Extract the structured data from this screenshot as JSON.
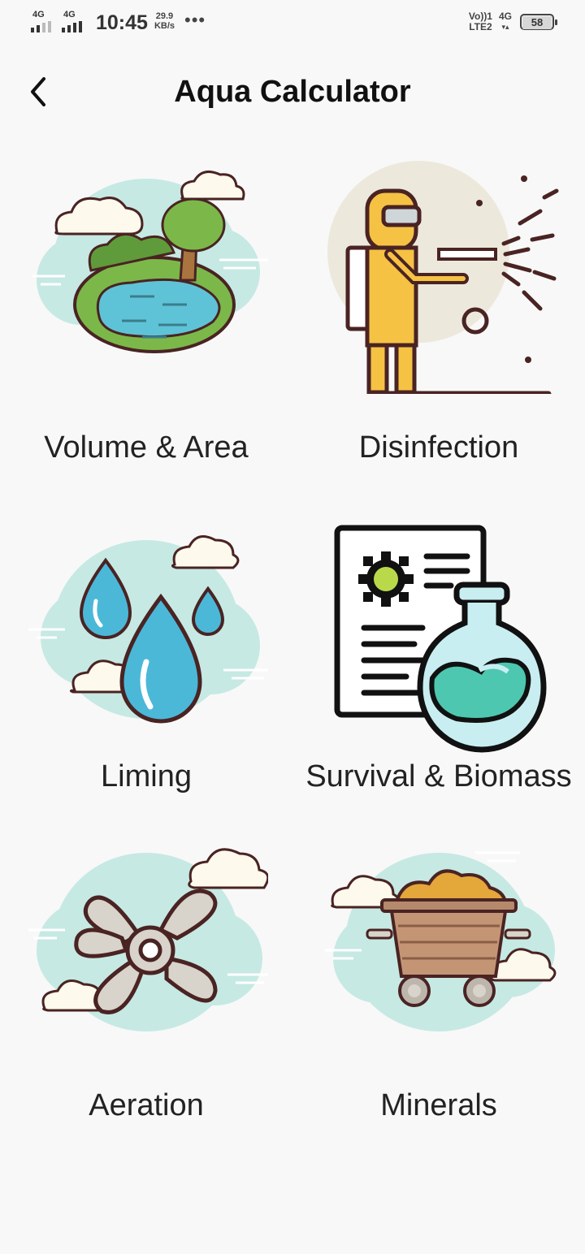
{
  "status_bar": {
    "network_1": "4G",
    "network_2": "4G",
    "time": "10:45",
    "speed_value": "29.9",
    "speed_unit": "KB/s",
    "more": "•••",
    "volte_1": "Vo))1",
    "volte_2": "LTE2",
    "network_right": "4G",
    "battery_level": "58"
  },
  "app_bar": {
    "title": "Aqua Calculator",
    "back_icon": "chevron-left-icon"
  },
  "tiles": [
    {
      "label": "Volume & Area",
      "icon": "pond-icon"
    },
    {
      "label": "Disinfection",
      "icon": "spraying-worker-icon"
    },
    {
      "label": "Liming",
      "icon": "water-drops-icon"
    },
    {
      "label": "Survival & Biomass",
      "icon": "lab-report-flask-icon"
    },
    {
      "label": "Aeration",
      "icon": "fan-icon"
    },
    {
      "label": "Minerals",
      "icon": "mine-cart-icon"
    }
  ],
  "colors": {
    "background": "#f8f8f8",
    "cloud_blue": "#c6e9e3",
    "water": "#5ec3d6",
    "grass": "#7bb849",
    "suit_yellow": "#f5c244",
    "outline": "#4a2323",
    "ore_gold": "#e3a73a"
  }
}
